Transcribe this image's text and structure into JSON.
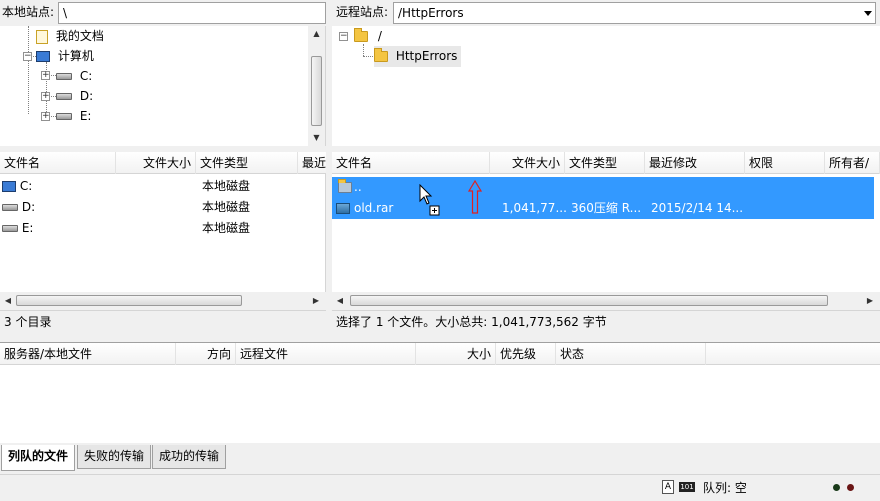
{
  "local": {
    "site_label": "本地站点:",
    "path": "\\",
    "tree": [
      {
        "label": "我的文档",
        "icon": "documents-icon"
      },
      {
        "label": "计算机",
        "icon": "computer-icon"
      },
      {
        "label": "C:",
        "icon": "drive-icon"
      },
      {
        "label": "D:",
        "icon": "drive-icon"
      },
      {
        "label": "E:",
        "icon": "drive-icon"
      }
    ],
    "columns": [
      "文件名",
      "文件大小",
      "文件类型",
      "最近"
    ],
    "files": [
      {
        "name": "C:",
        "type": "本地磁盘"
      },
      {
        "name": "D:",
        "type": "本地磁盘"
      },
      {
        "name": "E:",
        "type": "本地磁盘"
      }
    ],
    "status": "3 个目录"
  },
  "remote": {
    "site_label": "远程站点:",
    "path": "/HttpErrors",
    "tree": [
      {
        "label": "/"
      },
      {
        "label": "HttpErrors"
      }
    ],
    "columns": [
      "文件名",
      "文件大小",
      "文件类型",
      "最近修改",
      "权限",
      "所有者/"
    ],
    "files": [
      {
        "name": "..",
        "size": "",
        "type": "",
        "modified": ""
      },
      {
        "name": "old.rar",
        "size": "1,041,77...",
        "type": "360压缩 R...",
        "modified": "2015/2/14 14..."
      }
    ],
    "status": "选择了 1 个文件。大小总共: 1,041,773,562 字节"
  },
  "queue": {
    "columns": [
      "服务器/本地文件",
      "方向",
      "远程文件",
      "大小",
      "优先级",
      "状态"
    ],
    "tabs": [
      "列队的文件",
      "失败的传输",
      "成功的传输"
    ]
  },
  "statusbar": {
    "queue_label": "队列: 空"
  },
  "colors": {
    "selection": "#3399ff",
    "annotation_arrow": "#e02020"
  }
}
